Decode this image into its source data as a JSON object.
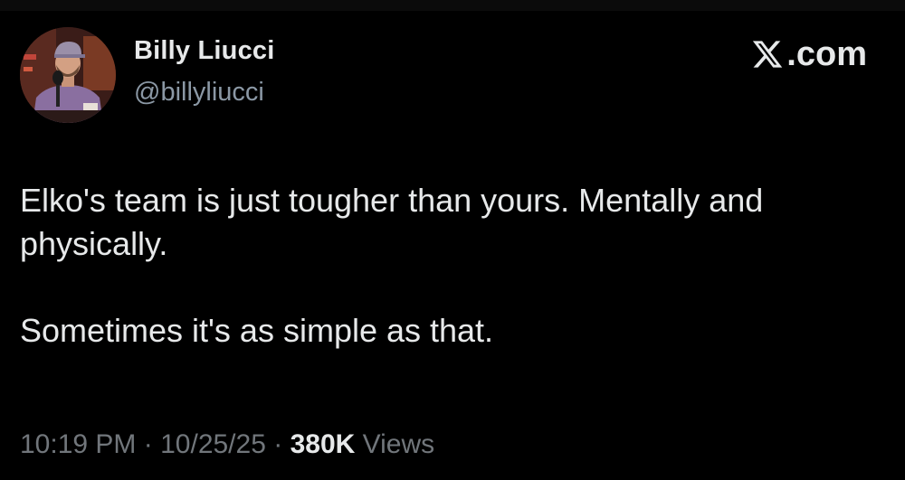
{
  "author": {
    "display_name": "Billy Liucci",
    "handle": "@billyliucci",
    "avatar_icon": "person-avatar-icon"
  },
  "brand": {
    "icon": "x-logo-icon",
    "text": ".com"
  },
  "post": {
    "paragraphs": [
      "Elko's team is just tougher than yours. Mentally and physically.",
      "Sometimes it's as simple as that."
    ]
  },
  "meta": {
    "time": "10:19 PM",
    "separator": "·",
    "date": "10/25/25",
    "views_count": "380K",
    "views_label": "Views"
  },
  "colors": {
    "background": "#000000",
    "text_primary": "#e7e9ea",
    "text_secondary": "#8b98a5",
    "meta_gray": "#71767b"
  }
}
